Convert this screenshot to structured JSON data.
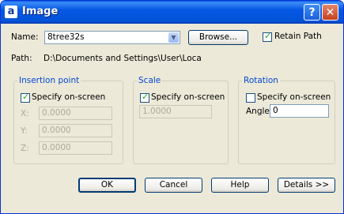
{
  "window": {
    "title": "Image",
    "app_icon_glyph": "a",
    "help_glyph": "?",
    "close_glyph": "✕"
  },
  "name_row": {
    "label": "Name:",
    "value": "8tree32s",
    "arrow": "▼",
    "browse_label": "Browse...",
    "retain_path_label": "Retain Path",
    "retain_path_checked": true
  },
  "path_row": {
    "label": "Path:",
    "value": "D:\\Documents and Settings\\User\\Local Setti"
  },
  "insertion_point": {
    "title": "Insertion point",
    "specify_label": "Specify on-screen",
    "specify_checked": true,
    "x_label": "X:",
    "x_value": "0.0000",
    "y_label": "Y:",
    "y_value": "0.0000",
    "z_label": "Z:",
    "z_value": "0.0000"
  },
  "scale": {
    "title": "Scale",
    "specify_label": "Specify on-screen",
    "specify_checked": true,
    "value": "1.0000"
  },
  "rotation": {
    "title": "Rotation",
    "specify_label": "Specify on-screen",
    "specify_checked": false,
    "angle_label": "Angle:",
    "angle_value": "0"
  },
  "buttons": {
    "ok": "OK",
    "cancel": "Cancel",
    "help": "Help",
    "details": "Details >>"
  },
  "colors": {
    "titlebar": "#0556e3",
    "window_bg": "#ece9d8",
    "group_title": "#0046d5",
    "close": "#c4401e"
  },
  "icons": [
    "app-icon",
    "help-icon",
    "close-icon",
    "chevron-down-icon",
    "checkmark-icon"
  ]
}
